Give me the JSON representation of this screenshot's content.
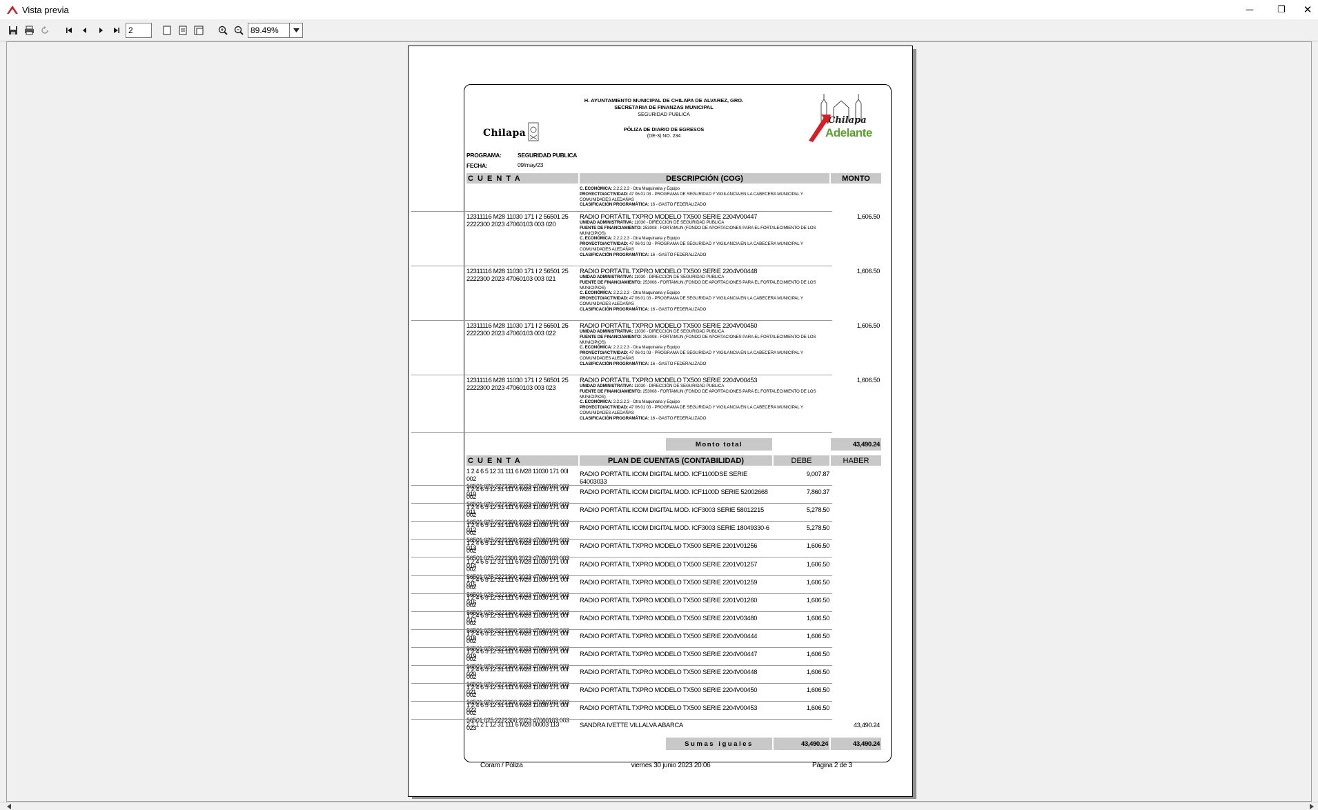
{
  "window": {
    "title": "Vista previa",
    "minimize": "─",
    "restore": "❐",
    "close": "✕"
  },
  "toolbar": {
    "page_number": "2",
    "zoom": "89.49%"
  },
  "report": {
    "header": {
      "line1": "H. AYUNTAMIENTO MUNICIPAL DE CHILAPA DE ALVAREZ, GRO.",
      "line2": "SECRETARIA DE FINANZAS MUNICIPAL",
      "line3": "SEGURIDAD PUBLICA",
      "line4": "PÓLIZA DE DIARIO DE EGRESOS",
      "line5": "(DE-3) NO. 234",
      "logo_left": "Chilapa",
      "logo_right_top": "Chilapa",
      "logo_right_bottom": "Adelante"
    },
    "programa_label": "PROGRAMA:",
    "programa_value": "SEGURIDAD PUBLICA",
    "fecha_label": "FECHA:",
    "fecha_value": "09/may/23",
    "top_headers": {
      "cuenta": "C U E N T A",
      "descripcion": "DESCRIPCIÓN (COG)",
      "monto": "MONTO"
    },
    "labels": {
      "economica": "C. ECONÓMICA:",
      "proyecto": "PROYECTO/ACTIVIDAD:",
      "clasificacion": "CLASIFICACIÓN PROGRAMÁTICA:",
      "unidad": "UNIDAD ADMINISTRATIVA:",
      "fuente": "FUENTE DE FINANCIAMIENTO:"
    },
    "values": {
      "economica": "2.2.2.2.3 - Otra Maquinaria y Equipo",
      "proyecto": "47 06 01 03 - PROGRAMA DE SEGURIDAD Y VIGILANCIA EN LA CABECERA MUNICIPAL Y COMUNIDADES ALEDAÑAS",
      "clasificacion": "16 - GASTO FEDERALIZADO",
      "unidad": "11030 - DIRECCIÓN DE SEGURIDAD PUBLICA",
      "fuente": "253008 - FORTAMUN (FONDO DE APORTACIONES PARA EL FORTALECIMIENTO DE LOS MUNICIPIOS)"
    },
    "entries": [
      {
        "cuenta": "12311116 M28 11030 171 I 2 56501 25 2222300 2023 47060103 003 020",
        "titulo": "RADIO PORTÁTIL TXPRO MODELO TX500 SERIE 2204V00447",
        "monto": "1,606.50"
      },
      {
        "cuenta": "12311116 M28 11030 171 I 2 56501 25 2222300 2023 47060103 003 021",
        "titulo": "RADIO PORTÁTIL TXPRO MODELO TX500 SERIE 2204V00448",
        "monto": "1,606.50"
      },
      {
        "cuenta": "12311116 M28 11030 171 I 2 56501 25 2222300 2023 47060103 003 022",
        "titulo": "RADIO PORTÁTIL TXPRO MODELO TX500 SERIE 2204V00450",
        "monto": "1,606.50"
      },
      {
        "cuenta": "12311116 M28 11030 171 I 2 56501 25 2222300 2023 47060103 003 023",
        "titulo": "RADIO PORTÁTIL TXPRO MODELO TX500 SERIE 2204V00453",
        "monto": "1,606.50"
      }
    ],
    "monto_total_label": "Monto total",
    "monto_total_value": "43,490.24",
    "plan_headers": {
      "cuenta": "C U E N T A",
      "plan": "PLAN DE CUENTAS (CONTABILIDAD)",
      "debe": "DEBE",
      "haber": "HABER"
    },
    "plan_rows": [
      {
        "cuenta1": "1 2 4 6 5 12 31 111 6 M28 11030 171 00I 002",
        "cuenta2": "56501 025 2222300 2023 47060103 003 010",
        "desc": "RADIO PORTÁTIL ICOM DIGITAL MOD. ICF1100DSE SERIE 64003033",
        "debe": "9,007.87",
        "haber": ""
      },
      {
        "cuenta1": "1 2 4 6 5 12 31 111 6 M28 11030 171 00I 002",
        "cuenta2": "56501 025 2222300 2023 47060103 003 011",
        "desc": "RADIO PORTÁTIL ICOM DIGITAL MOD. ICF1100D SERIE 52002668",
        "debe": "7,860.37",
        "haber": ""
      },
      {
        "cuenta1": "1 2 4 6 5 12 31 111 6 M28 11030 171 00I 002",
        "cuenta2": "56501 025 2222300 2023 47060103 003 012",
        "desc": "RADIO PORTÁTIL ICOM DIGITAL MOD. ICF3003 SERIE 58012215",
        "debe": "5,278.50",
        "haber": ""
      },
      {
        "cuenta1": "1 2 4 6 5 12 31 111 6 M28 11030 171 00I 002",
        "cuenta2": "56501 025 2222300 2023 47060103 003 013",
        "desc": "RADIO PORTÁTIL ICOM DIGITAL MOD. ICF3003 SERIE 18049330-6",
        "debe": "5,278.50",
        "haber": ""
      },
      {
        "cuenta1": "1 2 4 6 5 12 31 111 6 M28 11030 171 00I 002",
        "cuenta2": "56501 025 2222300 2023 47060103 003 014",
        "desc": "RADIO PORTÁTIL TXPRO MODELO TX500 SERIE 2201V01256",
        "debe": "1,606.50",
        "haber": ""
      },
      {
        "cuenta1": "1 2 4 6 5 12 31 111 6 M28 11030 171 00I 002",
        "cuenta2": "56501 025 2222300 2023 47060103 003 015",
        "desc": "RADIO PORTÁTIL TXPRO MODELO TX500 SERIE 2201V01257",
        "debe": "1,606.50",
        "haber": ""
      },
      {
        "cuenta1": "1 2 4 6 5 12 31 111 6 M28 11030 171 00I 002",
        "cuenta2": "56501 025 2222300 2023 47060103 003 016",
        "desc": "RADIO PORTÁTIL TXPRO MODELO TX500 SERIE 2201V01259",
        "debe": "1,606.50",
        "haber": ""
      },
      {
        "cuenta1": "1 2 4 6 5 12 31 111 6 M28 11030 171 00I 002",
        "cuenta2": "56501 025 2222300 2023 47060103 003 017",
        "desc": "RADIO PORTÁTIL TXPRO MODELO TX500 SERIE 2201V01260",
        "debe": "1,606.50",
        "haber": ""
      },
      {
        "cuenta1": "1 2 4 6 5 12 31 111 6 M28 11030 171 00I 002",
        "cuenta2": "56501 025 2222300 2023 47060103 003 018",
        "desc": "RADIO PORTÁTIL TXPRO MODELO TX500 SERIE 2201V03480",
        "debe": "1,606.50",
        "haber": ""
      },
      {
        "cuenta1": "1 2 4 6 5 12 31 111 6 M28 11030 171 00I 002",
        "cuenta2": "56501 025 2222300 2023 47060103 003 019",
        "desc": "RADIO PORTÁTIL TXPRO MODELO TX500 SERIE 2204V00444",
        "debe": "1,606.50",
        "haber": ""
      },
      {
        "cuenta1": "1 2 4 6 5 12 31 111 6 M28 11030 171 00I 002",
        "cuenta2": "56501 025 2222300 2023 47060103 003 020",
        "desc": "RADIO PORTÁTIL TXPRO MODELO TX500 SERIE 2204V00447",
        "debe": "1,606.50",
        "haber": ""
      },
      {
        "cuenta1": "1 2 4 6 5 12 31 111 6 M28 11030 171 00I 002",
        "cuenta2": "56501 025 2222300 2023 47060103 003 021",
        "desc": "RADIO PORTÁTIL TXPRO MODELO TX500 SERIE 2204V00448",
        "debe": "1,606.50",
        "haber": ""
      },
      {
        "cuenta1": "1 2 4 6 5 12 31 111 6 M28 11030 171 00I 002",
        "cuenta2": "56501 025 2222300 2023 47060103 003 022",
        "desc": "RADIO PORTÁTIL TXPRO MODELO TX500 SERIE 2204V00450",
        "debe": "1,606.50",
        "haber": ""
      },
      {
        "cuenta1": "1 2 4 6 5 12 31 111 6 M28 11030 171 00I 002",
        "cuenta2": "56501 025 2222300 2023 47060103 003 023",
        "desc": "RADIO PORTÁTIL TXPRO MODELO TX500 SERIE 2204V00453",
        "debe": "1,606.50",
        "haber": ""
      },
      {
        "cuenta1": "2 1 1 2 1 12 31 111 6 M28 00003 113",
        "cuenta2": "",
        "desc": "SANDRA IVETTE VILLALVA ABARCA",
        "debe": "",
        "haber": "43,490.24"
      }
    ],
    "sumas_label": "Sumas iguales",
    "sumas_debe": "43,490.24",
    "sumas_haber": "43,490.24",
    "footer": {
      "left": "Coram / Póliza",
      "center": "viernes 30 junio 2023 20:06",
      "right": "Página 2 de 3"
    }
  }
}
